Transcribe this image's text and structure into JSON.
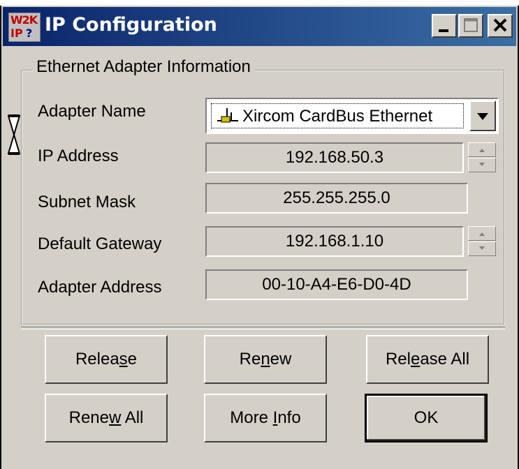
{
  "window": {
    "title": "IP Configuration",
    "icon_text_top": "W2K",
    "icon_text_bottom": "IP",
    "icon_text_q": "?",
    "controls": [
      "minimize-icon",
      "maximize-icon",
      "close-icon"
    ]
  },
  "group": {
    "legend": "Ethernet Adapter Information",
    "adapter_name_label": "Adapter Name",
    "adapter_name_value": "Xircom CardBus Ethernet",
    "ip_address_label": "IP Address",
    "ip_address_value": "192.168.50.3",
    "subnet_mask_label": "Subnet Mask",
    "subnet_mask_value": "255.255.255.0",
    "default_gateway_label": "Default Gateway",
    "default_gateway_value": "192.168.1.10",
    "adapter_address_label": "Adapter Address",
    "adapter_address_value": "00-10-A4-E6-D0-4D"
  },
  "buttons": {
    "release": {
      "pre": "Relea",
      "u": "s",
      "post": "e"
    },
    "renew": {
      "pre": "Re",
      "u": "n",
      "post": "ew"
    },
    "release_all": {
      "pre": "Rel",
      "u": "e",
      "post": "ase All"
    },
    "renew_all": {
      "pre": "Rene",
      "u": "w",
      "post": " All"
    },
    "more_info": {
      "pre": "More ",
      "u": "I",
      "post": "nfo"
    },
    "ok": "OK"
  },
  "colors": {
    "titlebar_start": "#0a246a",
    "titlebar_end": "#3a6ea5",
    "face": "#d4d0c8"
  }
}
